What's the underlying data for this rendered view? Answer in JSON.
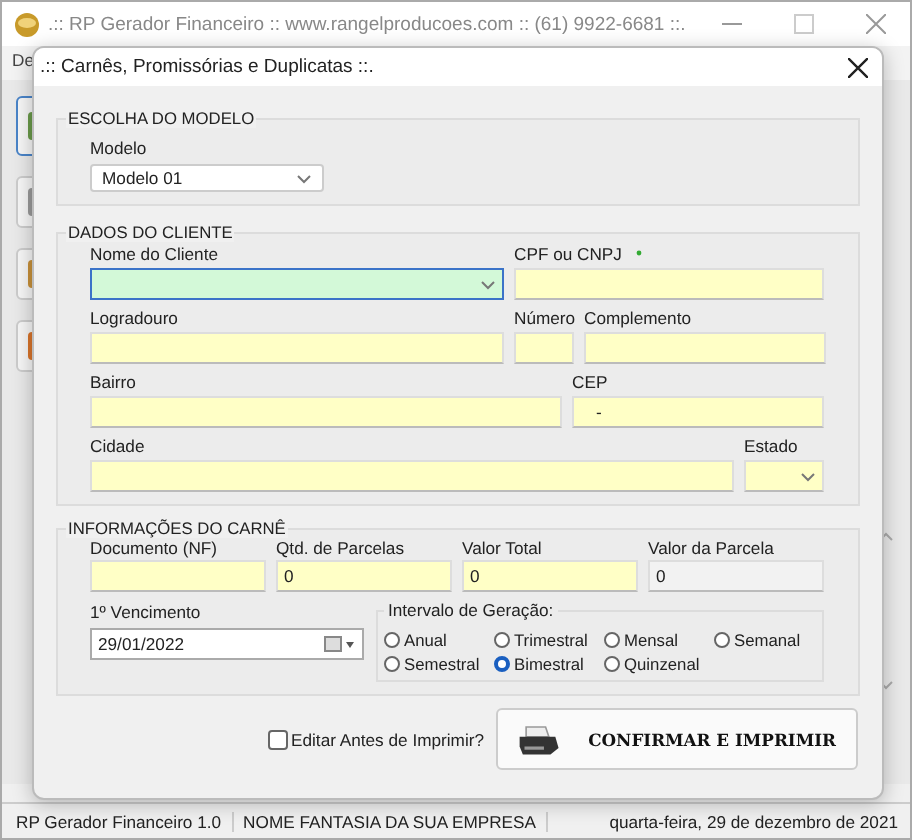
{
  "main_window": {
    "title": ".:: RP Gerador Financeiro :: www.rangelproducoes.com :: (61) 9922-6681 ::.",
    "menu_text": "De",
    "status_bar": [
      "RP Gerador Financeiro 1.0",
      "NOME FANTASIA DA SUA EMPRESA",
      "quarta-feira, 29 de dezembro de 2021"
    ]
  },
  "dialog": {
    "title": ".:: Carnês, Promissórias e Duplicatas ::.",
    "model_group": {
      "title": "ESCOLHA DO MODELO",
      "label": "Modelo",
      "value": "Modelo 01"
    },
    "client_group": {
      "title": "DADOS DO CLIENTE",
      "rows": [
        [
          {
            "label": "Nome do Cliente",
            "kind": "combo",
            "focused": true
          },
          {
            "label": "CPF ou CNPJ",
            "kind": "text",
            "focused": false
          }
        ],
        [
          {
            "label": "Logradouro",
            "kind": "text",
            "focused": false
          },
          {
            "label": "Número",
            "kind": "text",
            "focused": false
          },
          {
            "label": "Complemento",
            "kind": "text",
            "focused": false
          }
        ],
        [
          {
            "label": "Bairro",
            "kind": "text",
            "focused": false
          },
          {
            "label": "CEP",
            "kind": "text",
            "value": "-",
            "focused": false
          }
        ],
        [
          {
            "label": "Cidade",
            "kind": "text",
            "focused": false
          },
          {
            "label": "Estado",
            "kind": "combo",
            "focused": false
          }
        ]
      ]
    },
    "carne_group": {
      "title": "INFORMAÇÕES DO CARNÊ",
      "fields": [
        {
          "label": "Documento (NF)",
          "readonly": false
        },
        {
          "label": "Qtd. de Parcelas",
          "value": "0",
          "readonly": false
        },
        {
          "label": "Valor Total",
          "value": "0",
          "readonly": false
        },
        {
          "label": "Valor da Parcela",
          "value": "0",
          "readonly": true
        }
      ],
      "due_label": "1º Vencimento",
      "due_value": "29/01/2022",
      "interval": {
        "title": "Intervalo de Geração:",
        "options": [
          {
            "label": "Anual",
            "selected": false
          },
          {
            "label": "Trimestral",
            "selected": false
          },
          {
            "label": "Mensal",
            "selected": false
          },
          {
            "label": "Semanal",
            "selected": false
          },
          {
            "label": "Semestral",
            "selected": false
          },
          {
            "label": "Bimestral",
            "selected": true
          },
          {
            "label": "Quinzenal",
            "selected": false
          }
        ]
      }
    },
    "edit_before_print": {
      "label": "Editar Antes de Imprimir?",
      "checked": false
    },
    "confirm_button": "CONFIRMAR E IMPRIMIR"
  }
}
